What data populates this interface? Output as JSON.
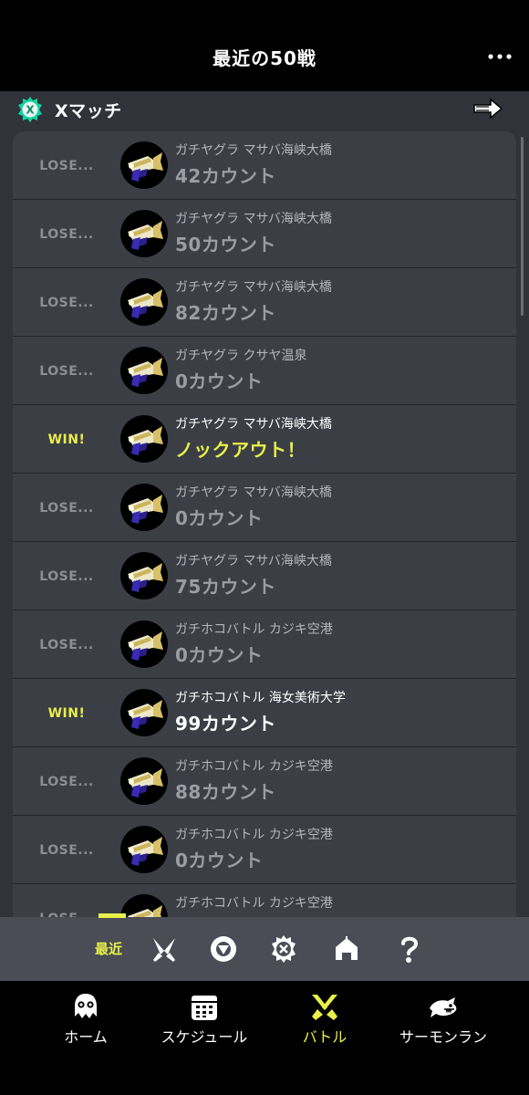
{
  "header": {
    "title": "最近の50戦"
  },
  "section": {
    "title": "Xマッチ"
  },
  "battles": [
    {
      "result": "LOSE...",
      "mode_stage": "ガチヤグラ マサバ海峡大橋",
      "score": "42カウント",
      "win": false
    },
    {
      "result": "LOSE...",
      "mode_stage": "ガチヤグラ マサバ海峡大橋",
      "score": "50カウント",
      "win": false
    },
    {
      "result": "LOSE...",
      "mode_stage": "ガチヤグラ マサバ海峡大橋",
      "score": "82カウント",
      "win": false
    },
    {
      "result": "LOSE...",
      "mode_stage": "ガチヤグラ クサヤ温泉",
      "score": "0カウント",
      "win": false
    },
    {
      "result": "WIN!",
      "mode_stage": "ガチヤグラ マサバ海峡大橋",
      "score": "ノックアウト！",
      "win": true,
      "knockout": true
    },
    {
      "result": "LOSE...",
      "mode_stage": "ガチヤグラ マサバ海峡大橋",
      "score": "0カウント",
      "win": false
    },
    {
      "result": "LOSE...",
      "mode_stage": "ガチヤグラ マサバ海峡大橋",
      "score": "75カウント",
      "win": false
    },
    {
      "result": "LOSE...",
      "mode_stage": "ガチホコバトル カジキ空港",
      "score": "0カウント",
      "win": false
    },
    {
      "result": "WIN!",
      "mode_stage": "ガチホコバトル 海女美術大学",
      "score": "99カウント",
      "win": true
    },
    {
      "result": "LOSE...",
      "mode_stage": "ガチホコバトル カジキ空港",
      "score": "88カウント",
      "win": false
    },
    {
      "result": "LOSE...",
      "mode_stage": "ガチホコバトル カジキ空港",
      "score": "0カウント",
      "win": false
    },
    {
      "result": "LOSE...",
      "mode_stage": "ガチホコバトル カジキ空港",
      "score": "",
      "win": false
    }
  ],
  "filter": {
    "recent_label": "最近",
    "icons": [
      "regular-battle-icon",
      "anarchy-battle-icon",
      "x-match-icon",
      "challenge-icon",
      "private-battle-icon"
    ]
  },
  "nav": {
    "items": [
      {
        "label": "ホーム",
        "icon": "squid-home-icon",
        "active": false
      },
      {
        "label": "スケジュール",
        "icon": "calendar-icon",
        "active": false
      },
      {
        "label": "バトル",
        "icon": "battle-icon",
        "active": true
      },
      {
        "label": "サーモンラン",
        "icon": "salmon-icon",
        "active": false
      }
    ]
  },
  "colors": {
    "accent": "#e8f04a",
    "background": "#31333a",
    "card": "#3b3e45",
    "filter_bar": "#4a4d55"
  }
}
